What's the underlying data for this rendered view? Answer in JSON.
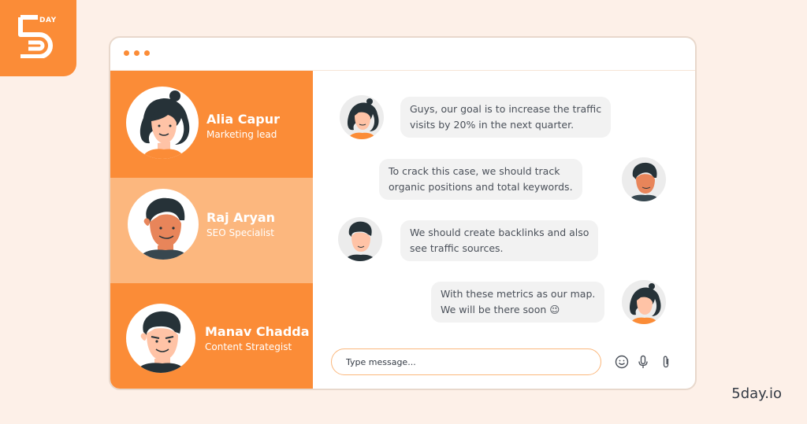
{
  "brand": {
    "logo_text": "DAY",
    "site": "5day.io",
    "accent": "#fb8c37",
    "accent_light": "#fbb77c"
  },
  "sidebar": {
    "contacts": [
      {
        "name": "Alia Capur",
        "role": "Marketing lead",
        "avatar": "woman-avatar-icon",
        "bg": "#fb8c37"
      },
      {
        "name": "Raj Aryan",
        "role": "SEO Specialist",
        "avatar": "man-avatar-icon",
        "bg": "#fcb77e"
      },
      {
        "name": "Manav Chadda",
        "role": "Content Strategist",
        "avatar": "man-avatar-icon",
        "bg": "#fb8c37"
      }
    ]
  },
  "chat": {
    "messages": [
      {
        "side": "left",
        "lines": [
          "Guys, our goal is to increase the traffic",
          "visits by 20% in the next quarter."
        ]
      },
      {
        "side": "right",
        "lines": [
          "To crack this case, we should track",
          "organic positions and total keywords."
        ]
      },
      {
        "side": "left",
        "lines": [
          "We should create backlinks and also",
          "see traffic sources."
        ]
      },
      {
        "side": "right",
        "lines": [
          "With these metrics as our map.",
          "We will be there soon 😉"
        ]
      }
    ],
    "composer": {
      "placeholder": "Type message..."
    },
    "tools": [
      "emoji-icon",
      "microphone-icon",
      "paperclip-icon"
    ]
  }
}
